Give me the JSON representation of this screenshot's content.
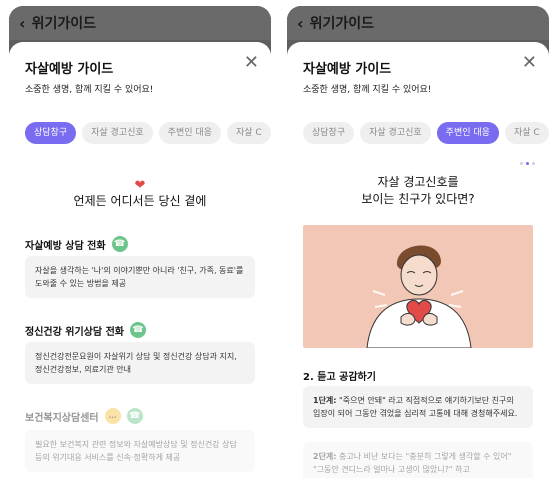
{
  "left": {
    "topbar": {
      "back": "‹",
      "title": "위기가이드"
    },
    "sheet": {
      "title": "자살예방 가이드",
      "subtitle": "소중한 생명, 함께 지킬 수 있어요!",
      "close": "✕",
      "tabs": [
        "상담창구",
        "자살 경고신호",
        "주변인 대응",
        "자살 C"
      ]
    },
    "hero": "언제든 어디서든 당신 곁에",
    "sections": [
      {
        "title": "자살예방 상담 전화",
        "desc": "자살을 생각하는 '나'의 이야기뿐만 아니라 '친구, 가족, 동료'를 도와줄 수 있는 방법을 제공"
      },
      {
        "title": "정신건강 위기상담 전화",
        "desc": "정신건강전문요원이 자살위기 상담 및 정신건강 상담과 지지, 정신건강정보, 의료기관 안내"
      },
      {
        "title": "보건복지상담센터",
        "desc": "필요한 보건복지 관련 정보와 자살예방상담 및 정신건강 상담 등의 위기대응 서비스를 신속·정확하게 제공"
      }
    ]
  },
  "right": {
    "topbar": {
      "back": "‹",
      "title": "위기가이드"
    },
    "sheet": {
      "title": "자살예방 가이드",
      "subtitle": "소중한 생명, 함께 지킬 수 있어요!",
      "close": "✕",
      "tabs": [
        "상담창구",
        "자살 경고신호",
        "주변인 대응",
        "자살 C"
      ]
    },
    "headline_l1": "자살 경고신호를",
    "headline_l2": "보이는 친구가 있다면?",
    "step_title": "2. 듣고 공감하기",
    "step1": {
      "label": "1단계:",
      "text": " \"죽으면 안돼\" 라고 직접적으로 얘기하기보단 친구의 입장이 되어 그동안 겪었을 심리적 고통에 대해 경청해주세요."
    },
    "step2": {
      "label": "2단계:",
      "text": " 충고나 비난 보다는 \"충분히 그렇게 생각할 수 있어\" \"그동안 견디느라 얼마나 고생이 많았니?\" 하고"
    }
  }
}
